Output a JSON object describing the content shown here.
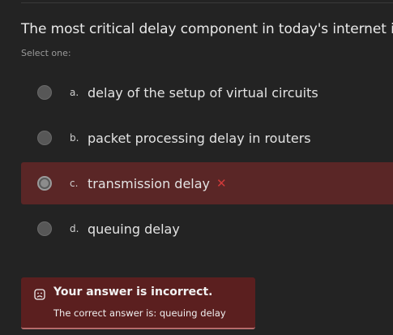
{
  "question": {
    "text": "The most critical delay component in today's internet is:",
    "prompt": "Select one:"
  },
  "options": [
    {
      "letter": "a.",
      "text": "delay of the setup of virtual circuits",
      "selected": false
    },
    {
      "letter": "b.",
      "text": "packet processing delay in routers",
      "selected": false
    },
    {
      "letter": "c.",
      "text": "transmission delay",
      "selected": true,
      "mark": "x-mark-icon"
    },
    {
      "letter": "d.",
      "text": "queuing delay",
      "selected": false
    }
  ],
  "feedback": {
    "icon": "sad-face-icon",
    "title": "Your answer is incorrect.",
    "detail": "The correct answer is: queuing delay"
  },
  "colors": {
    "background": "#232323",
    "selected_row": "#5a2626",
    "feedback_bg": "#5b1f1f",
    "incorrect_mark": "#d23a3a"
  }
}
